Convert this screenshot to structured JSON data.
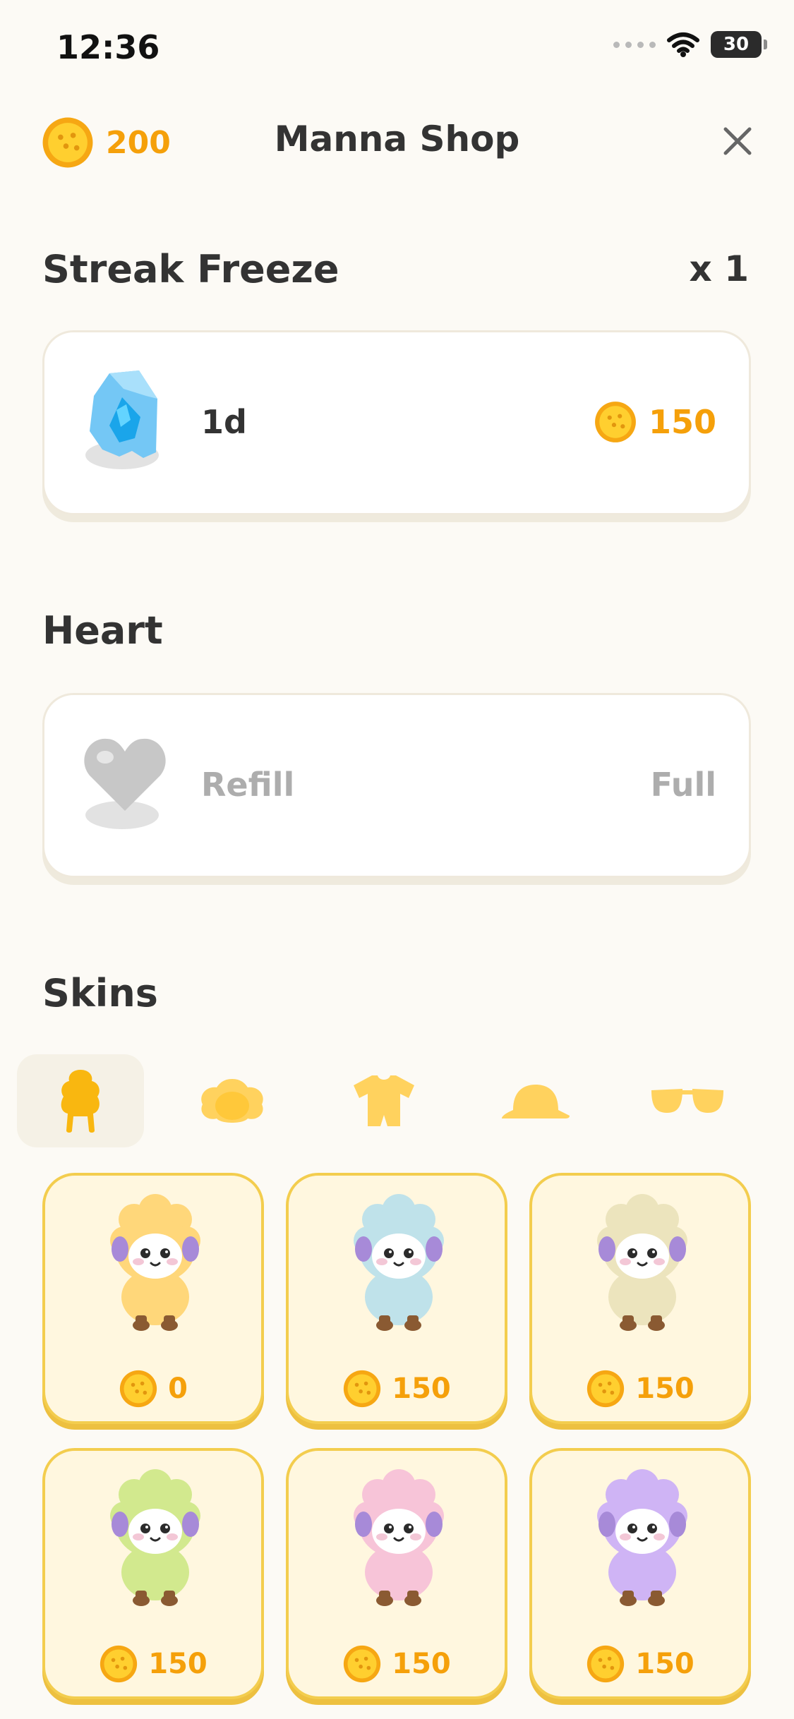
{
  "status_bar": {
    "time": "12:36",
    "battery": "30"
  },
  "header": {
    "balance": "200",
    "title": "Manna Shop"
  },
  "streak_freeze": {
    "title": "Streak Freeze",
    "count": "x 1",
    "item_label": "1d",
    "price": "150"
  },
  "heart": {
    "title": "Heart",
    "item_label": "Refill",
    "status": "Full"
  },
  "skins": {
    "title": "Skins",
    "tabs": [
      {
        "name": "body-icon",
        "active": true
      },
      {
        "name": "wool-icon",
        "active": false
      },
      {
        "name": "outfit-icon",
        "active": false
      },
      {
        "name": "hat-icon",
        "active": false
      },
      {
        "name": "glasses-icon",
        "active": false
      }
    ],
    "items": [
      {
        "price": "0",
        "color": "#ffd77a"
      },
      {
        "price": "150",
        "color": "#bfe2ea"
      },
      {
        "price": "150",
        "color": "#ece4bd"
      },
      {
        "price": "150",
        "color": "#d2e98e"
      },
      {
        "price": "150",
        "color": "#f7c4d8"
      },
      {
        "price": "150",
        "color": "#cfb4f5"
      }
    ]
  },
  "colors": {
    "accent": "#f5a00a",
    "card_border": "#f3cd4e",
    "background": "#fcfaf5"
  }
}
